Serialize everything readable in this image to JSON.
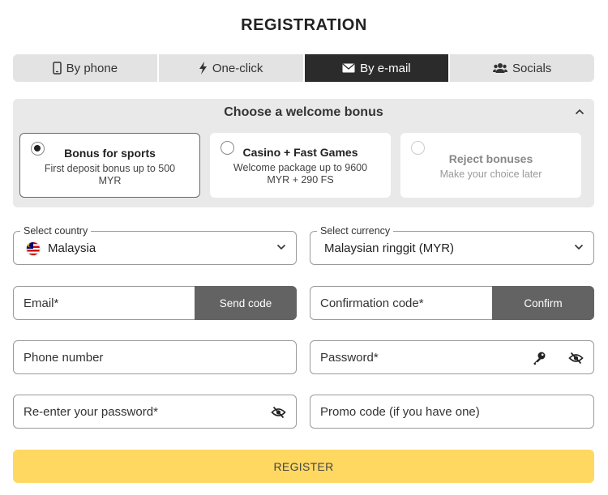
{
  "page": {
    "title": "REGISTRATION"
  },
  "tabs": [
    {
      "label": "By phone",
      "icon": "smartphone-icon"
    },
    {
      "label": "One-click",
      "icon": "lightning-icon"
    },
    {
      "label": "By e-mail",
      "icon": "envelope-icon",
      "active": true
    },
    {
      "label": "Socials",
      "icon": "users-icon"
    }
  ],
  "bonus": {
    "heading": "Choose a welcome bonus",
    "options": [
      {
        "title": "Bonus for sports",
        "desc": "First deposit bonus up to 500 MYR",
        "selected": true
      },
      {
        "title": "Casino + Fast Games",
        "desc": "Welcome package up to 9600 MYR + 290 FS",
        "selected": false
      },
      {
        "title": "Reject bonuses",
        "desc": "Make your choice later",
        "selected": false
      }
    ]
  },
  "form": {
    "country": {
      "legend": "Select country",
      "value": "Malaysia"
    },
    "currency": {
      "legend": "Select currency",
      "value": "Malaysian ringgit (MYR)"
    },
    "email": {
      "placeholder": "Email*",
      "action": "Send code"
    },
    "confirmation": {
      "placeholder": "Confirmation code*",
      "action": "Confirm"
    },
    "phone": {
      "placeholder": "Phone number"
    },
    "password": {
      "placeholder": "Password*"
    },
    "repassword": {
      "placeholder": "Re-enter your password*"
    },
    "promo": {
      "placeholder": "Promo code (if you have one)"
    }
  },
  "register": {
    "label": "REGISTER"
  },
  "colors": {
    "accent": "#ffd862",
    "active_tab": "#2b2b2b",
    "action_button": "#636363",
    "panel": "#e9e9e9"
  }
}
